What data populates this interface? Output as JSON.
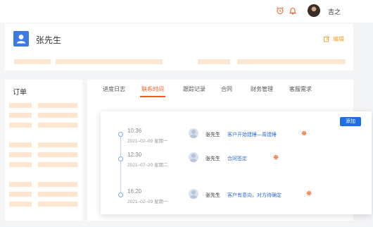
{
  "colors": {
    "accent": "#f15a22",
    "primary": "#1f6ee8",
    "skeleton": "#fbe6d2"
  },
  "header": {
    "icons": [
      "alarm-clock-icon",
      "bell-icon"
    ],
    "username": "吉之"
  },
  "profile": {
    "name": "张先生",
    "avatar_icon": "user-icon",
    "edit_label": "编辑"
  },
  "orders": {
    "title": "订单"
  },
  "tabs": [
    {
      "label": "进度日志",
      "active": false
    },
    {
      "label": "联系时间",
      "active": true
    },
    {
      "label": "跟踪记录",
      "active": false
    },
    {
      "label": "合同",
      "active": false
    },
    {
      "label": "财务管理",
      "active": false
    },
    {
      "label": "客服需求",
      "active": false
    }
  ],
  "timeline": {
    "add_label": "添加",
    "entries": [
      {
        "time": "10:36",
        "date": "2021–02–09  星期一",
        "person": "张先生",
        "content": "客户开始建睡—周建睡"
      },
      {
        "time": "12:30",
        "date": "2021–07–20  星期二",
        "person": "张先生",
        "content": "合同签定"
      },
      {
        "time": "16:20",
        "date": "2021–02–09  星期一",
        "person": "张先生",
        "content": "客户有意向，对方待确定"
      }
    ]
  }
}
